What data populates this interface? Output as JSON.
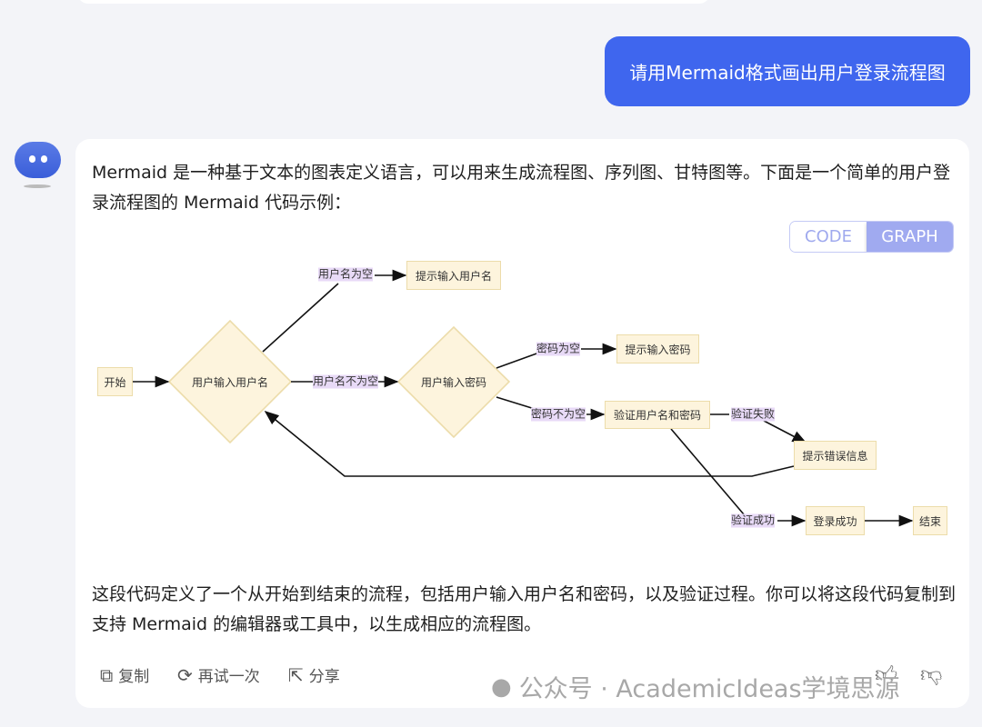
{
  "user_message": "请用Mermaid格式画出用户登录流程图",
  "assistant": {
    "intro": "Mermaid 是一种基于文本的图表定义语言，可以用来生成流程图、序列图、甘特图等。下面是一个简单的用户登录流程图的 Mermaid 代码示例：",
    "outro": "这段代码定义了一个从开始到结束的流程，包括用户输入用户名和密码，以及验证过程。你可以将这段代码复制到支持 Mermaid 的编辑器或工具中，以生成相应的流程图。",
    "view_toggle": {
      "code": "CODE",
      "graph": "GRAPH",
      "selected": "GRAPH"
    },
    "actions": {
      "copy": "复制",
      "retry": "再试一次",
      "share": "分享"
    }
  },
  "flowchart": {
    "nodes": {
      "start": "开始",
      "input_username": "用户输入用户名",
      "prompt_username": "提示输入用户名",
      "input_password": "用户输入密码",
      "prompt_password": "提示输入密码",
      "verify": "验证用户名和密码",
      "error": "提示错误信息",
      "success": "登录成功",
      "end": "结束"
    },
    "edges": {
      "username_empty": "用户名为空",
      "username_not_empty": "用户名不为空",
      "password_empty": "密码为空",
      "password_not_empty": "密码不为空",
      "verify_fail": "验证失败",
      "verify_success": "验证成功"
    },
    "colors": {
      "node_fill": "#fdf4dd",
      "node_border": "#ecdcaa",
      "edge_label_bg": "#e8daf7"
    }
  },
  "watermark": "公众号 · AcademicIdeas学境思源",
  "colors": {
    "user_bubble": "#3f66ee",
    "toggle_active": "#a0aaf0"
  }
}
